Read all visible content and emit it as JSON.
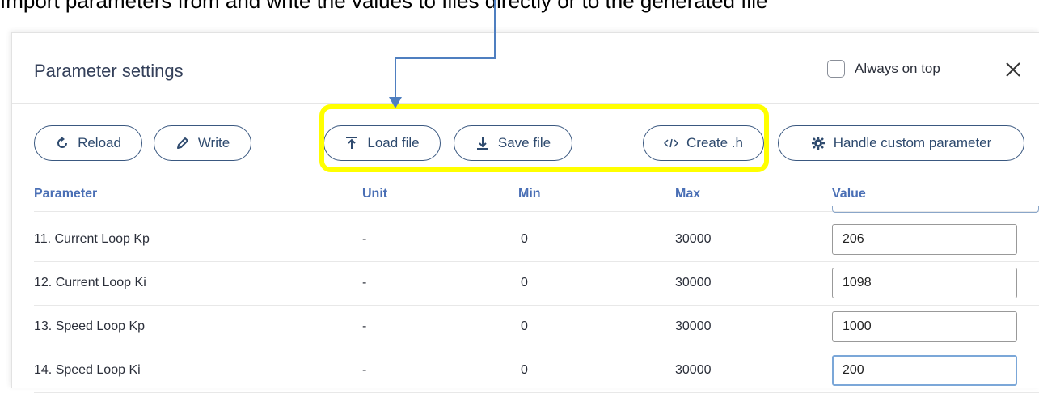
{
  "caption": "Import parameters from and write the values to files directly or to the generated file",
  "dialog": {
    "title": "Parameter settings",
    "always_on_top_label": "Always on top"
  },
  "toolbar": {
    "reload_label": "Reload",
    "write_label": "Write",
    "load_file_label": "Load file",
    "save_file_label": "Save file",
    "create_h_label": "Create .h",
    "handle_custom_label": "Handle custom parameter"
  },
  "table": {
    "columns": [
      "Parameter",
      "Unit",
      "Min",
      "Max",
      "Value"
    ],
    "rows": [
      {
        "parameter": "11. Current Loop Kp",
        "unit": "-",
        "min": "0",
        "max": "30000",
        "value": "206"
      },
      {
        "parameter": "12. Current Loop Ki",
        "unit": "-",
        "min": "0",
        "max": "30000",
        "value": "1098"
      },
      {
        "parameter": "13. Speed Loop Kp",
        "unit": "-",
        "min": "0",
        "max": "30000",
        "value": "1000"
      },
      {
        "parameter": "14. Speed Loop Ki",
        "unit": "-",
        "min": "0",
        "max": "30000",
        "value": "200"
      }
    ]
  },
  "annotation": {
    "highlight_color": "#ffff00",
    "arrow_color": "#4f7fc0"
  },
  "colors": {
    "accent": "#2e4a6e",
    "header_text": "#4a6fb5"
  }
}
